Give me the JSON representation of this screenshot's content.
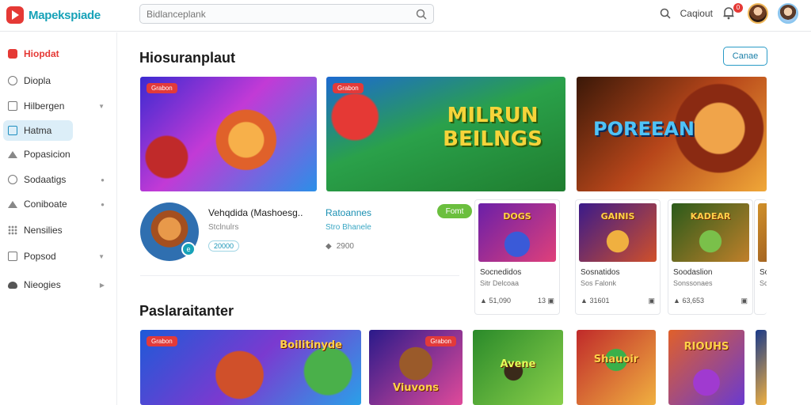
{
  "app": {
    "logo_text": "Mapekspiade"
  },
  "search": {
    "placeholder": "Bidlanceplank"
  },
  "topbar": {
    "link_label": "Caqiout",
    "notification_count": "0"
  },
  "sidebar": {
    "items": [
      {
        "label": "Hiopdat"
      },
      {
        "label": "Diopla"
      },
      {
        "label": "Hilbergen"
      },
      {
        "label": "Hatma"
      },
      {
        "label": "Popasicion"
      },
      {
        "label": "Sodaatigs"
      },
      {
        "label": "Coniboate"
      },
      {
        "label": "Nensilies"
      },
      {
        "label": "Popsod"
      },
      {
        "label": "Nieogies"
      }
    ]
  },
  "main": {
    "section1_title": "Hiosuranplaut",
    "section1_button": "Canae",
    "banners": [
      {
        "tag": "Grabon",
        "title": ""
      },
      {
        "tag": "Grabon",
        "title": "MILRUN BEILNGS"
      },
      {
        "tag": "",
        "title": "POREEAN"
      }
    ],
    "featured": {
      "title": "Vehqdida (Mashoesg..",
      "sub": "Stclnulrs",
      "pill": "20000",
      "badge": "e",
      "title2": "Ratoannes",
      "sub2": "Stro Bhanele",
      "meta2": "2900",
      "action": "Fomt"
    },
    "cards": [
      {
        "thumb": "DOGS",
        "title": "Socnedidos",
        "sub": "Sitr Delcoaa",
        "rating": "51,090",
        "count": "13"
      },
      {
        "thumb": "GAINIS",
        "title": "Sosnatidos",
        "sub": "Sos Falonk",
        "rating": "31601",
        "count": ""
      },
      {
        "thumb": "KADEAR",
        "title": "Soodaslion",
        "sub": "Sonssonaes",
        "rating": "63,653",
        "count": ""
      },
      {
        "thumb": "",
        "title": "So",
        "sub": "Sc",
        "rating": "",
        "count": ""
      }
    ],
    "section2_title": "Paslaraitanter",
    "games": [
      {
        "tag": "Grabon",
        "title": "Boilitinyde"
      },
      {
        "tag": "Grabon",
        "title": "Viuvons"
      },
      {
        "tag": "",
        "title": "Avene"
      },
      {
        "tag": "",
        "title": "Shauoir"
      },
      {
        "tag": "",
        "title": "RIOUHS"
      },
      {
        "tag": "",
        "title": ""
      }
    ]
  }
}
